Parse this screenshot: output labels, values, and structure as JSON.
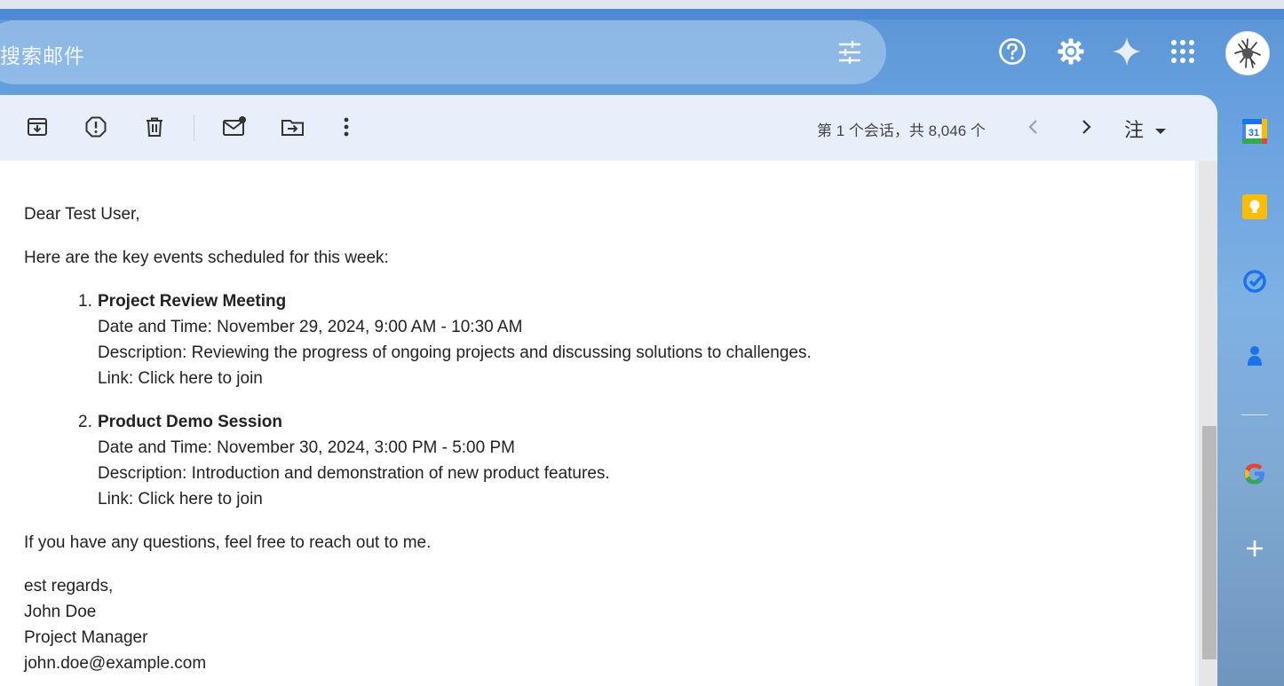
{
  "search": {
    "placeholder": "搜索邮件"
  },
  "header": {
    "icons": [
      "tune-icon",
      "help-icon",
      "settings-icon",
      "gemini-sparkle-icon",
      "apps-grid-icon",
      "avatar"
    ]
  },
  "toolbar": {
    "icons": [
      "archive-icon",
      "report-spam-icon",
      "delete-icon",
      "mark-unread-icon",
      "move-to-icon",
      "more-vert-icon"
    ],
    "count": "第 1 个会话，共 8,046 个",
    "lang": "注"
  },
  "email": {
    "greeting": "Dear Test User,",
    "intro": "Here are the key events scheduled for this week:",
    "events": [
      {
        "num": "1.",
        "title": "Project Review Meeting",
        "datetime": "Date and Time: November 29, 2024, 9:00 AM - 10:30 AM",
        "description": "Description: Reviewing the progress of ongoing projects and discussing solutions to challenges.",
        "link": "Link: Click here to join"
      },
      {
        "num": "2.",
        "title": "Product Demo Session",
        "datetime": "Date and Time: November 30, 2024, 3:00 PM - 5:00 PM",
        "description": "Description: Introduction and demonstration of new product features.",
        "link": "Link: Click here to join"
      }
    ],
    "closing": "If you have any questions, feel free to reach out to me.",
    "signature": {
      "regards": "est regards,",
      "name": "John Doe",
      "role": "Project Manager",
      "email": "john.doe@example.com"
    }
  },
  "side_panel": {
    "calendar_day": "31",
    "icons": [
      "calendar-icon",
      "keep-icon",
      "tasks-icon",
      "contacts-icon",
      "google-icon",
      "add-icon"
    ]
  },
  "colors": {
    "accent_blue": "#1a73e8",
    "keep_yellow": "#fbbc04",
    "text": "#222222"
  }
}
